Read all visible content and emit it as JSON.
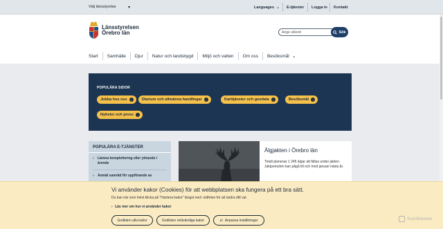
{
  "topbar": {
    "county_select": "Välj länsstyrelse",
    "languages": "Languages",
    "eservices": "E-tjänster",
    "login": "Logga in",
    "contact": "Kontakt"
  },
  "header": {
    "brand_line1": "Länsstyrelsen",
    "brand_line2": "Örebro län",
    "search_placeholder": "Ange sökord",
    "search_button": "Sök"
  },
  "nav": {
    "items": [
      "Start",
      "Samhälle",
      "Djur",
      "Natur och landsbygd",
      "Miljö och vatten",
      "Om oss",
      "Besöksmål"
    ]
  },
  "popular": {
    "title": "POPULÄRA SIDOR",
    "pills": [
      "Jobba hos oss",
      "Diarium och allmänna handlingar",
      "Karttjänster och geodata",
      "Besöksmål",
      "Nyheter och press"
    ]
  },
  "eservices": {
    "title": "POPULÄRA E-TJÄNSTER",
    "links": [
      "Lämna komplettering eller yttrande i ärende",
      "Anmäl samråd för uppförande av"
    ]
  },
  "news": {
    "title": "Älgjakten i Örebro län",
    "text": "Totalt planeras 1 245 älgar att fällas under jakten. Jaktperioden kan pågå till och med januari nästa år."
  },
  "cookie": {
    "title": "Vi använder kakor (Cookies) för att webbplatsen ska fungera på ett bra sätt.",
    "text": "Du kan när som helst klicka på \"Hantera kakor\" längst ned i sidfoten för att ändra ditt val.",
    "link": "Läs mer om hur vi använder kakor",
    "btn_all": "Godkänn alla kakor",
    "btn_necessary": "Godkänn nödvändiga kakor",
    "btn_adjust": "Anpassa inställningar"
  },
  "watermark": "ScanMalware",
  "colors": {
    "navy": "#1c3552",
    "accent_yellow": "#f6c14b",
    "cookie_bg": "#fbebc3",
    "eservice_bg": "#c9d6e0"
  }
}
